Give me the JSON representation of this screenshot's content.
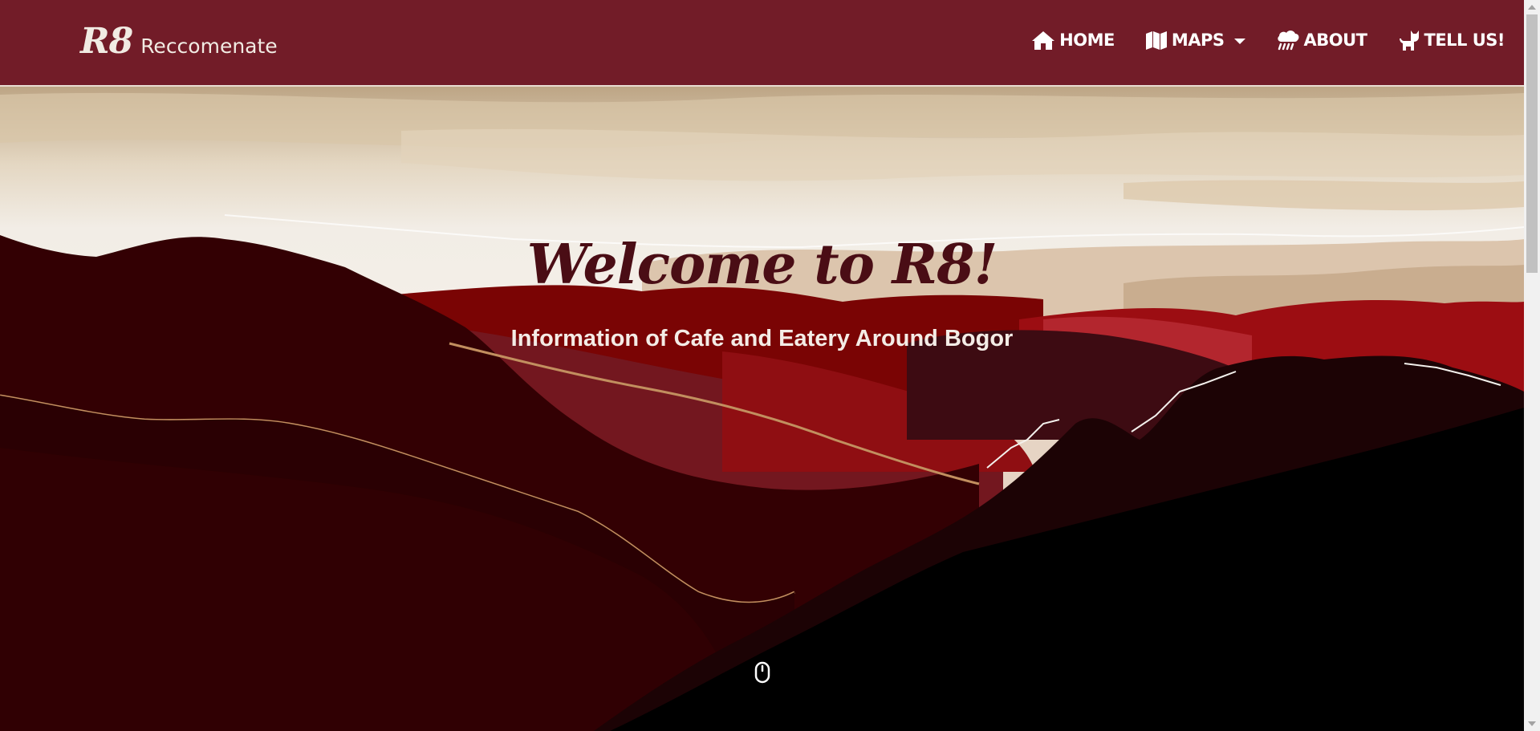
{
  "brand": {
    "logo": "R8",
    "name": "Reccomenate"
  },
  "nav": {
    "items": [
      {
        "label": "HOME",
        "icon": "home-icon"
      },
      {
        "label": "MAPS",
        "icon": "map-icon",
        "dropdown": true
      },
      {
        "label": "ABOUT",
        "icon": "cloud-rain-icon"
      },
      {
        "label": "TELL US!",
        "icon": "cat-icon"
      }
    ]
  },
  "hero": {
    "title": "Welcome to R8!",
    "subtitle": "Information of Cafe and Eatery Around Bogor",
    "scroll_icon": "mouse-icon"
  },
  "colors": {
    "navbar": "#721c28",
    "brand_text": "#f1ebe3",
    "hero_title": "#4a0d15",
    "hero_subtitle": "#f4ece6"
  }
}
